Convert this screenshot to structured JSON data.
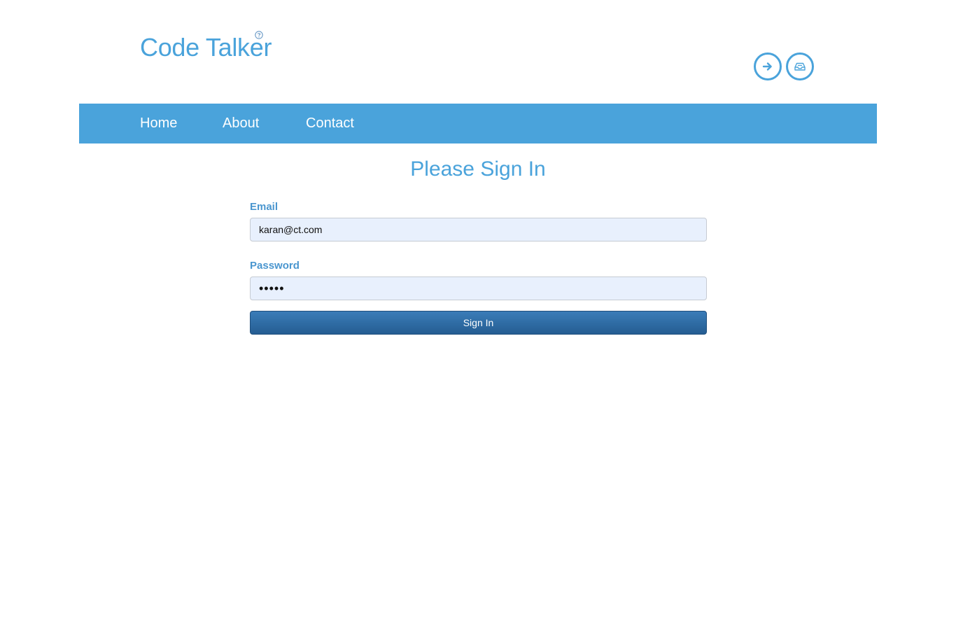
{
  "app": {
    "logo_text": "Code Talker",
    "help_icon": "question-circle-icon"
  },
  "header_actions": [
    {
      "name": "sign-in-arrow-icon",
      "icon": "arrow-right"
    },
    {
      "name": "inbox-icon",
      "icon": "inbox-tray"
    }
  ],
  "nav": {
    "items": [
      {
        "label": "Home"
      },
      {
        "label": "About"
      },
      {
        "label": "Contact"
      }
    ]
  },
  "main": {
    "title": "Please Sign In",
    "email_label": "Email",
    "email_value": "karan@ct.com",
    "password_label": "Password",
    "password_value": "•••••",
    "submit_label": "Sign In"
  },
  "colors": {
    "accent": "#4aa3db",
    "button": "#255d92",
    "input_bg": "#e8f0fd"
  }
}
